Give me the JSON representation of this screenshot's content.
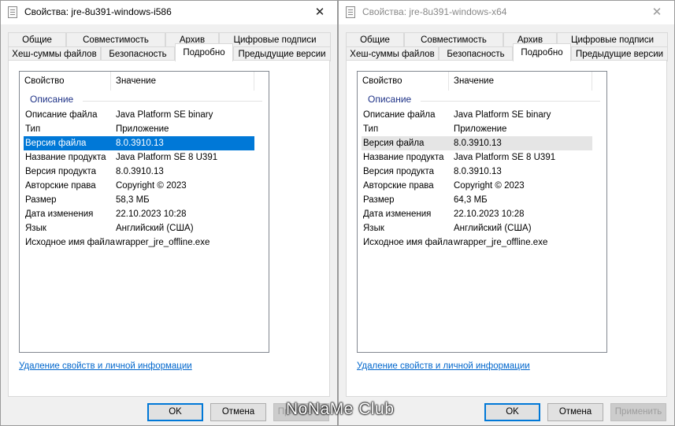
{
  "left": {
    "title": "Свойства: jre-8u391-windows-i586",
    "close": "✕",
    "tabs_row1": [
      "Общие",
      "Совместимость",
      "Архив",
      "Цифровые подписи"
    ],
    "tabs_row2": [
      "Хеш-суммы файлов",
      "Безопасность",
      "Подробно",
      "Предыдущие версии"
    ],
    "columns": [
      "Свойство",
      "Значение"
    ],
    "group": "Описание",
    "rows": [
      [
        "Описание файла",
        "Java Platform SE binary"
      ],
      [
        "Тип",
        "Приложение"
      ],
      [
        "Версия файла",
        "8.0.3910.13"
      ],
      [
        "Название продукта",
        "Java Platform SE 8 U391"
      ],
      [
        "Версия продукта",
        "8.0.3910.13"
      ],
      [
        "Авторские права",
        "Copyright © 2023"
      ],
      [
        "Размер",
        "58,3 МБ"
      ],
      [
        "Дата изменения",
        "22.10.2023 10:28"
      ],
      [
        "Язык",
        "Английский (США)"
      ],
      [
        "Исходное имя файла",
        "wrapper_jre_offline.exe"
      ]
    ],
    "link": "Удаление свойств и личной информации",
    "buttons": [
      "OK",
      "Отмена",
      "Применить"
    ]
  },
  "right": {
    "title": "Свойства: jre-8u391-windows-x64",
    "close": "✕",
    "tabs_row1": [
      "Общие",
      "Совместимость",
      "Архив",
      "Цифровые подписи"
    ],
    "tabs_row2": [
      "Хеш-суммы файлов",
      "Безопасность",
      "Подробно",
      "Предыдущие версии"
    ],
    "columns": [
      "Свойство",
      "Значение"
    ],
    "group": "Описание",
    "rows": [
      [
        "Описание файла",
        "Java Platform SE binary"
      ],
      [
        "Тип",
        "Приложение"
      ],
      [
        "Версия файла",
        "8.0.3910.13"
      ],
      [
        "Название продукта",
        "Java Platform SE 8 U391"
      ],
      [
        "Версия продукта",
        "8.0.3910.13"
      ],
      [
        "Авторские права",
        "Copyright © 2023"
      ],
      [
        "Размер",
        "64,3 МБ"
      ],
      [
        "Дата изменения",
        "22.10.2023 10:28"
      ],
      [
        "Язык",
        "Английский (США)"
      ],
      [
        "Исходное имя файла",
        "wrapper_jre_offline.exe"
      ]
    ],
    "link": "Удаление свойств и личной информации",
    "buttons": [
      "OK",
      "Отмена",
      "Применить"
    ]
  },
  "watermark": "NoNaMe Club",
  "colors": {
    "selection": "#0078d7",
    "link": "#0066cc",
    "group_header": "#1e3287"
  }
}
